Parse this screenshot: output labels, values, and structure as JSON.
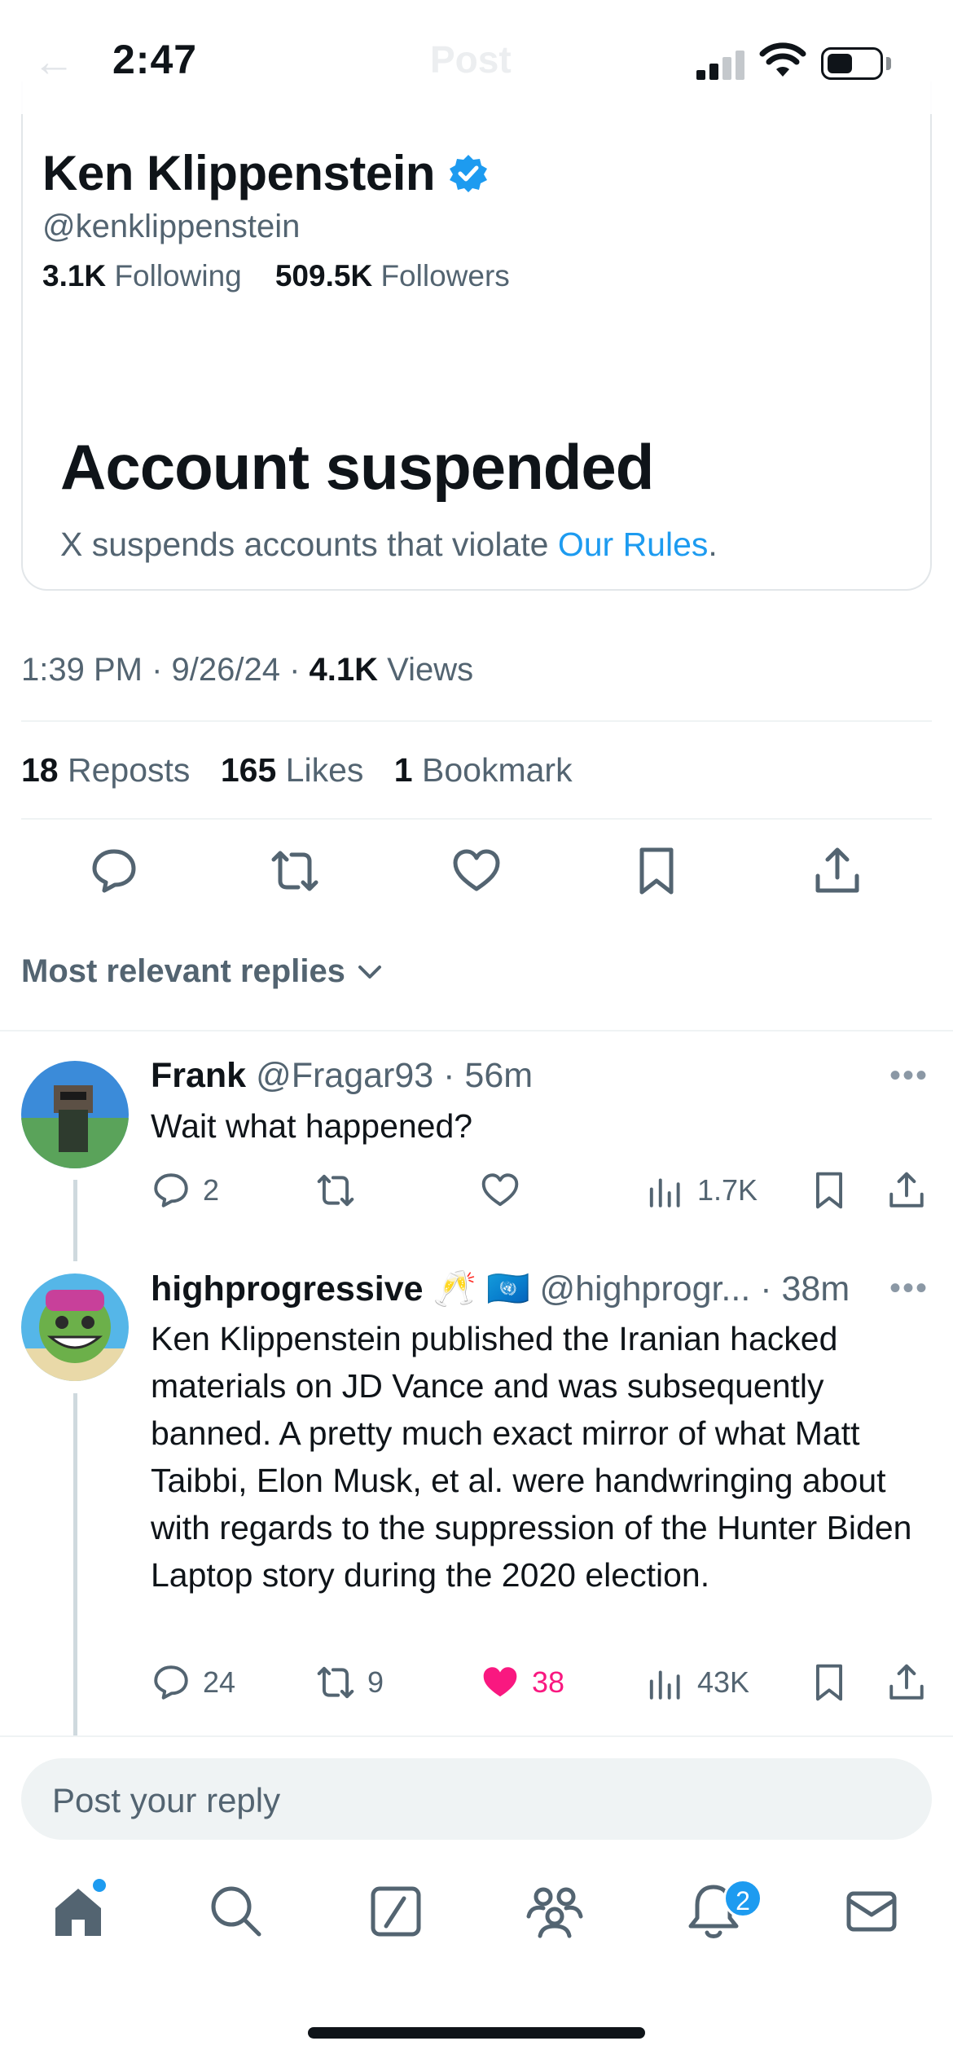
{
  "status_bar": {
    "time": "2:47",
    "ghost_title": "Post"
  },
  "profile_card": {
    "name": "Ken Klippenstein",
    "handle": "@kenklippenstein",
    "following_count": "3.1K",
    "following_label": "Following",
    "followers_count": "509.5K",
    "followers_label": "Followers",
    "suspended_title": "Account suspended",
    "suspended_text": "X suspends accounts that violate ",
    "rules_link": "Our Rules",
    "suspended_end": "."
  },
  "post_meta": {
    "time": "1:39 PM",
    "date": "9/26/24",
    "views_count": "4.1K",
    "views_label": "Views"
  },
  "engagement": {
    "reposts_count": "18",
    "reposts_label": "Reposts",
    "likes_count": "165",
    "likes_label": "Likes",
    "bookmarks_count": "1",
    "bookmarks_label": "Bookmark"
  },
  "action_icons": [
    "reply-icon",
    "repost-icon",
    "like-icon",
    "bookmark-icon",
    "share-icon"
  ],
  "replies_sort": {
    "label": "Most relevant replies"
  },
  "replies": [
    {
      "name": "Frank",
      "emoji": "",
      "handle": "@Fragar93",
      "time": "56m",
      "text": "Wait what happened?",
      "reply_count": "2",
      "repost_count": "",
      "like_count": "",
      "views": "1.7K",
      "liked": false
    },
    {
      "name": "highprogressive",
      "emoji": "🥂 🇺🇳",
      "handle": "@highprogr...",
      "time": "38m",
      "text": "Ken Klippenstein published the Iranian hacked materials on JD Vance and was subsequently banned. A pretty much exact mirror of what Matt Taibbi, Elon Musk, et al. were handwringing about with regards to the suppression of the Hunter Biden Laptop story during the 2020 election.",
      "reply_count": "24",
      "repost_count": "9",
      "like_count": "38",
      "views": "43K",
      "liked": true
    }
  ],
  "composer": {
    "placeholder": "Post your reply"
  },
  "tabbar": {
    "items": [
      "home-icon",
      "search-icon",
      "grok-icon",
      "communities-icon",
      "notifications-icon",
      "messages-icon"
    ],
    "notification_badge": "2"
  },
  "colors": {
    "accent": "#1d9bf0",
    "like": "#f91880",
    "muted": "#536471"
  }
}
